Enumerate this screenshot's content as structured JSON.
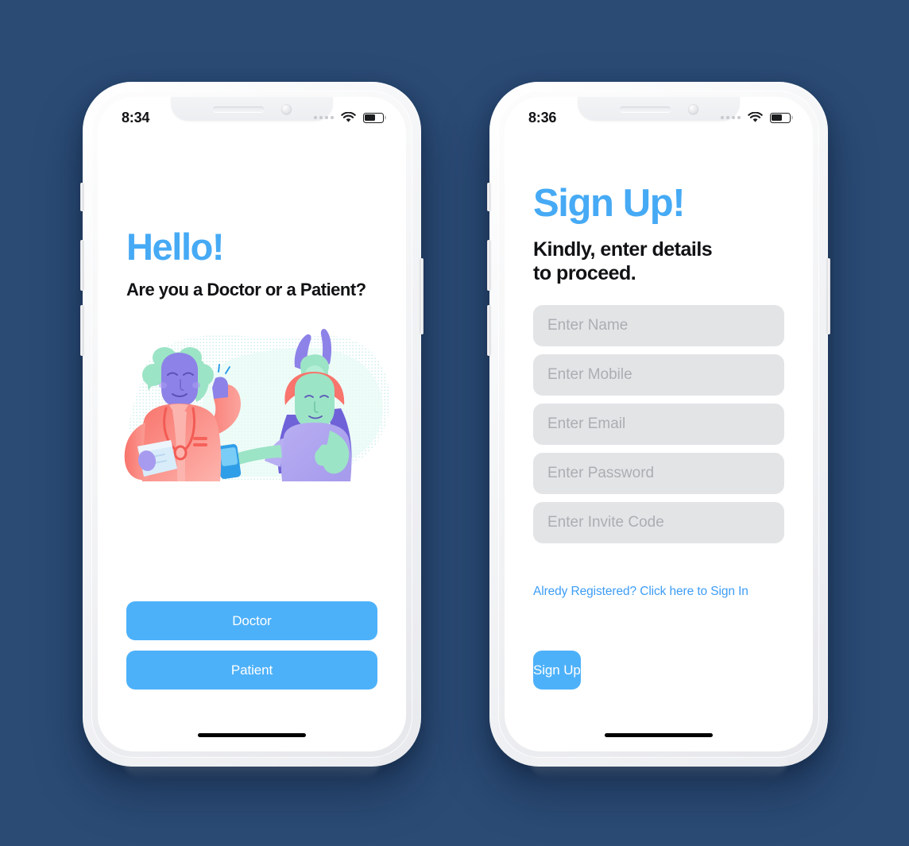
{
  "canvas": {
    "background_color": "#2b4b75",
    "accent_color": "#46aaf5",
    "button_color": "#4db1fa",
    "field_color": "#e3e4e6",
    "placeholder_color": "#abaeb2"
  },
  "screen_one": {
    "status_bar": {
      "time": "8:34",
      "signal_icon": "signal-dots-icon",
      "wifi_icon": "wifi-icon",
      "battery_icon": "battery-icon"
    },
    "title": "Hello!",
    "subtitle": "Are you a Doctor or a Patient?",
    "illustration_alt": "doctor-and-patient-illustration",
    "buttons": [
      {
        "label": "Doctor",
        "name": "doctor-button"
      },
      {
        "label": "Patient",
        "name": "patient-button"
      }
    ]
  },
  "screen_two": {
    "status_bar": {
      "time": "8:36",
      "signal_icon": "signal-dots-icon",
      "wifi_icon": "wifi-icon",
      "battery_icon": "battery-icon"
    },
    "title": "Sign Up!",
    "subtitle": "Kindly,  enter details\nto proceed.",
    "fields": [
      {
        "placeholder": "Enter Name",
        "name": "name-input",
        "value": ""
      },
      {
        "placeholder": "Enter Mobile",
        "name": "mobile-input",
        "value": ""
      },
      {
        "placeholder": "Enter Email",
        "name": "email-input",
        "value": ""
      },
      {
        "placeholder": "Enter Password",
        "name": "password-input",
        "value": ""
      },
      {
        "placeholder": "Enter Invite Code",
        "name": "invite-code-input",
        "value": ""
      }
    ],
    "signin_link": "Alredy Registered? Click here to Sign In",
    "submit_label": "Sign Up"
  }
}
